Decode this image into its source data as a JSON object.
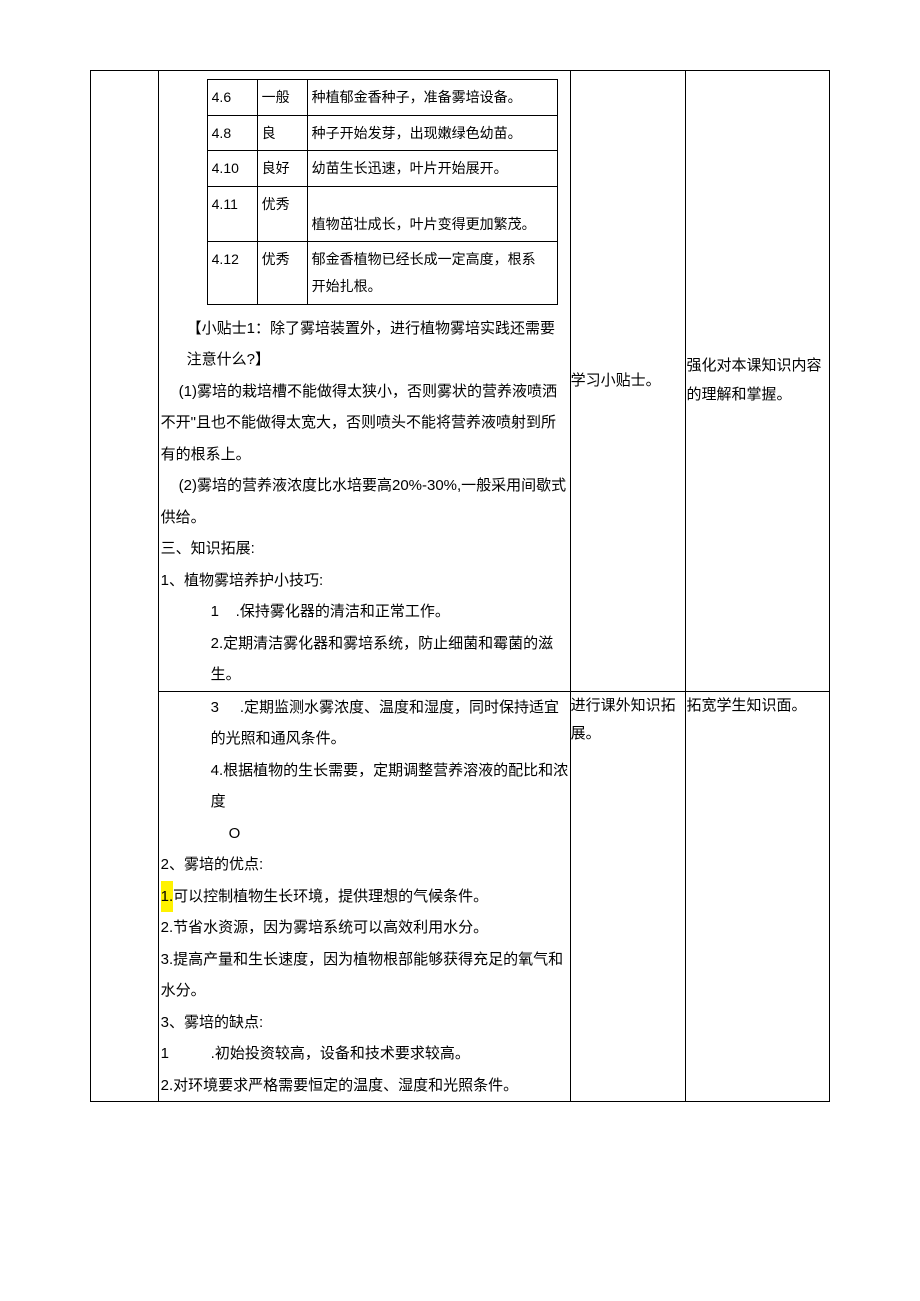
{
  "observations": [
    {
      "date": "4.6",
      "rating": "一般",
      "note": "种植郁金香种子，准备雾培设备。"
    },
    {
      "date": "4.8",
      "rating": "良",
      "note": "种子开始发芽，出现嫩绿色幼苗。"
    },
    {
      "date": "4.10",
      "rating": "良好",
      "note": "幼苗生长迅速，叶片开始展开。"
    },
    {
      "date": "4.11",
      "rating": "优秀",
      "note": "植物茁壮成长，叶片变得更加繁茂。"
    },
    {
      "date": "4.12",
      "rating": "优秀",
      "note": "郁金香植物已经长成一定高度，根系开始扎根。"
    }
  ],
  "tip1": {
    "title": "【小贴士1：除了雾培装置外，进行植物雾培实践还需要注意什么?】",
    "items": [
      "(1)雾培的栽培槽不能做得太狭小，否则雾状的营养液喷洒不开\"且也不能做得太宽大，否则喷头不能将营养液喷射到所有的根系上。",
      "(2)雾培的营养液浓度比水培要高20%-30%,一般采用间歇式供给。"
    ]
  },
  "section3_title": "三、知识拓展:",
  "s3_1_title": "1、植物雾培养护小技巧:",
  "s3_1_items_num": [
    "1",
    "3"
  ],
  "s3_1_items": [
    ".保持雾化器的清洁和正常工作。",
    "2.定期清洁雾化器和雾培系统，防止细菌和霉菌的滋生。",
    ".定期监测水雾浓度、温度和湿度，同时保持适宜的光照和通风条件。",
    "4.根据植物的生长需要，定期调整营养溶液的配比和浓度"
  ],
  "s3_1_tail": "O",
  "s3_2_title": "2、雾培的优点:",
  "s3_2_hl": "1.",
  "s3_2_items": [
    "可以控制植物生长环境，提供理想的气候条件。",
    "2.节省水资源，因为雾培系统可以高效利用水分。",
    "3.提高产量和生长速度，因为植物根部能够获得充足的氧气和水分。"
  ],
  "s3_3_title": "3、雾培的缺点:",
  "s3_3_num1": "1",
  "s3_3_items": [
    ".初始投资较高，设备和技术要求较高。",
    "2.对环境要求严格需要恒定的温度、湿度和光照条件。"
  ],
  "side": {
    "r1a": "学习小贴士。",
    "r2a": "强化对本课知识内容的理解和掌握。",
    "r1b": "进行课外知识拓展。",
    "r2b": "拓宽学生知识面。"
  }
}
